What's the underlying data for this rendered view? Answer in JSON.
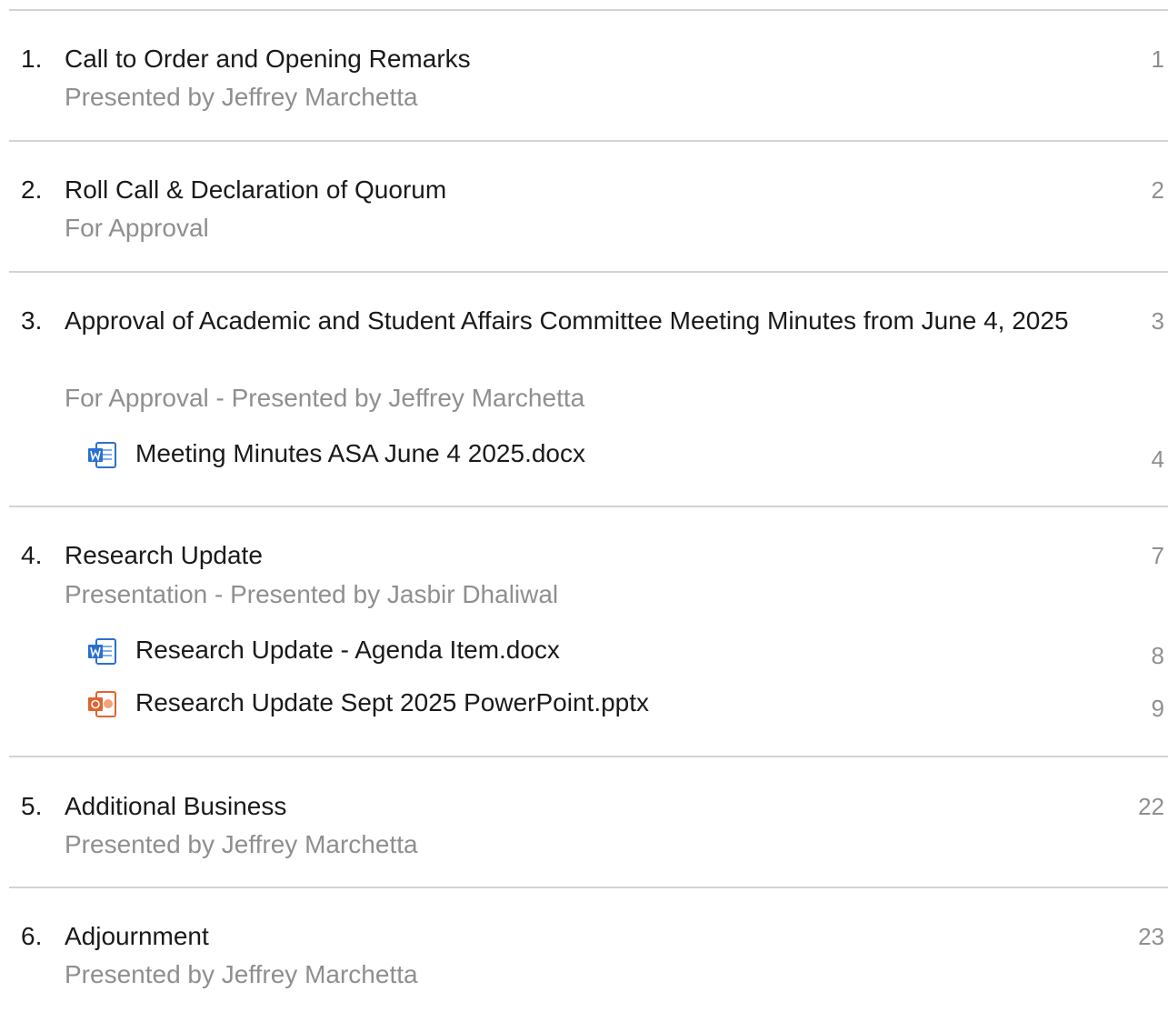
{
  "agenda": {
    "items": [
      {
        "number": "1.",
        "title": "Call to Order and Opening Remarks",
        "subtitle": "Presented by Jeffrey Marchetta",
        "page": "1",
        "attachments": []
      },
      {
        "number": "2.",
        "title": "Roll Call & Declaration of Quorum",
        "subtitle": "For Approval",
        "page": "2",
        "attachments": []
      },
      {
        "number": "3.",
        "title": "Approval of Academic and Student Affairs Committee Meeting Minutes from June 4, 2025",
        "subtitle": "For Approval - Presented by Jeffrey Marchetta",
        "page": "3",
        "attachments": [
          {
            "name": "Meeting Minutes ASA June 4 2025.docx",
            "icon": "word-document-icon",
            "page": "4"
          }
        ]
      },
      {
        "number": "4.",
        "title": "Research Update",
        "subtitle": "Presentation - Presented by Jasbir Dhaliwal",
        "page": "7",
        "attachments": [
          {
            "name": "Research Update - Agenda Item.docx",
            "icon": "word-document-icon",
            "page": "8"
          },
          {
            "name": "Research Update Sept 2025 PowerPoint.pptx",
            "icon": "powerpoint-document-icon",
            "page": "9"
          }
        ]
      },
      {
        "number": "5.",
        "title": "Additional Business",
        "subtitle": "Presented by Jeffrey Marchetta",
        "page": "22",
        "attachments": []
      },
      {
        "number": "6.",
        "title": "Adjournment",
        "subtitle": "Presented by Jeffrey Marchetta",
        "page": "23",
        "attachments": []
      }
    ]
  },
  "colors": {
    "text": "#1a1a1a",
    "muted": "#8f8f8f",
    "divider": "#d3d3d3",
    "word_icon": "#2b6fd1",
    "powerpoint_icon": "#e0642e"
  }
}
